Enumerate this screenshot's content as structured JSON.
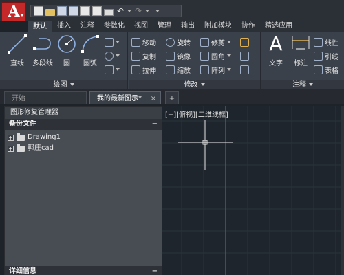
{
  "app": {
    "logo_letter": "A"
  },
  "qat": {
    "icons": [
      "new-icon",
      "open-icon",
      "save-icon",
      "saveas-icon",
      "export-icon",
      "publish-icon",
      "print-icon",
      "undo-icon",
      "redo-icon"
    ]
  },
  "ribbon_tabs": [
    "默认",
    "插入",
    "注释",
    "参数化",
    "视图",
    "管理",
    "输出",
    "附加模块",
    "协作",
    "精选应用"
  ],
  "ribbon": {
    "draw": {
      "tools": [
        "直线",
        "多段线",
        "圆",
        "圆弧"
      ],
      "footer": "绘图"
    },
    "modify": {
      "rows": [
        [
          "移动",
          "旋转",
          "修剪"
        ],
        [
          "复制",
          "镜像",
          "圆角"
        ],
        [
          "拉伸",
          "缩放",
          "阵列"
        ]
      ],
      "footer": "修改"
    },
    "annotate": {
      "tools": [
        "文字",
        "标注"
      ],
      "small": [
        "线性",
        "引线",
        "表格"
      ],
      "footer": "注释"
    }
  },
  "file_tabs": {
    "start": "开始",
    "current": "我的最新图示*",
    "close": "×",
    "plus": "+"
  },
  "left_panel": {
    "title": "图形修复管理器",
    "backup_section": "备份文件",
    "collapse": "−",
    "items": [
      "Drawing1",
      "郭庄cad"
    ],
    "detail_section": "详细信息"
  },
  "canvas": {
    "view_label": "[−][俯视][二维线框]"
  },
  "colors": {
    "app_red": "#c52828",
    "ribbon_bg": "#3b414a",
    "canvas_bg": "#1f252c",
    "axis_green": "#2a8a3a"
  }
}
